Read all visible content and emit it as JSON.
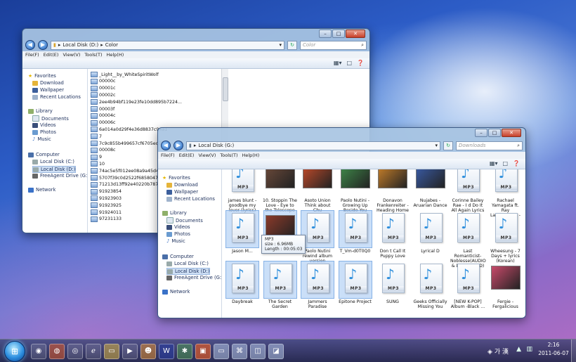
{
  "back_window": {
    "address": [
      "Local Disk (D:)",
      "Color"
    ],
    "search_placeholder": "Color",
    "menu": [
      "File(F)",
      "Edit(E)",
      "View(V)",
      "Tools(T)",
      "Help(H)"
    ],
    "nav": {
      "favorites": "Favorites",
      "download": "Download",
      "wallpaper": "Wallpaper",
      "recent": "Recent Locations",
      "library": "Library",
      "documents": "Documents",
      "videos": "Videos",
      "photos": "Photos",
      "music": "Music",
      "computer": "Computer",
      "drive_c": "Local Disk (C:)",
      "drive_d": "Local Disk (D:)",
      "drive_g": "FreeAgent Drive (G:)",
      "network": "Network"
    },
    "files": [
      "_Light__by_WhiteSpiritWolf",
      "00000c",
      "00001c",
      "00002c",
      "2ee4b94bf119e23fe10dd895b7224...",
      "00003f",
      "00004c",
      "00006c",
      "6a014a0d29f4e36d8837c94a1",
      "7",
      "7c9c855b499657cf6705ed7fc9",
      "00008c",
      "9",
      "10",
      "74ac5e5f012ee08a9a45d4ad07",
      "5707f39c0d2522f6858047c145",
      "71213d13ff92e40220b787a8d7",
      "91923854",
      "91923903",
      "91923925",
      "91924011",
      "97231133"
    ]
  },
  "front_window": {
    "address": [
      "Local Disk (G:)"
    ],
    "search_placeholder": "Downloads",
    "menu": [
      "File(F)",
      "Edit(E)",
      "View(V)",
      "Tools(T)",
      "Help(H)"
    ],
    "nav": {
      "favorites": "Favorites",
      "download": "Download",
      "wallpaper": "Wallpaper",
      "recent": "Recent Locations",
      "library": "Library",
      "documents": "Documents",
      "videos": "Videos",
      "photos": "Photos",
      "music": "Music",
      "computer": "Computer",
      "drive_c": "Local Disk (C:)",
      "drive_d": "Local Disk (D:)",
      "drive_g": "FreeAgent Drive (G:)",
      "network": "Network"
    },
    "mp3_badge": "MP3",
    "row1": [
      {
        "caption": "james blunt - goodbye my lover (lyrics)",
        "kind": "mp3"
      },
      {
        "caption": "10. Stoppin The Love - Eye to the Telescope",
        "kind": "photo",
        "color": "#6b4a3a"
      },
      {
        "caption": "Asoto Union Think about Chu",
        "kind": "photo",
        "color": "#c24b2a"
      },
      {
        "caption": "Paolo Nutini - Growing Up Beside You",
        "kind": "photo",
        "color": "#3f8a4a"
      },
      {
        "caption": "Donavon Frankenreiter - Heading Home",
        "kind": "photo",
        "color": "#c9802a"
      },
      {
        "caption": "Nujabes - Aruarian Dance",
        "kind": "photo",
        "color": "#3a5ca8"
      },
      {
        "caption": "Corinne Bailey Rae - I d Do It All Again Lyrics",
        "kind": "mp3"
      },
      {
        "caption": "Rachael Yamagata ft. Ray Lamontagne - Duet",
        "kind": "mp3"
      }
    ],
    "row2": [
      {
        "caption": "Jason M...",
        "kind": "mp3",
        "selected": true
      },
      {
        "caption": "",
        "kind": "photo",
        "color": "#8a3a2a",
        "selected": true
      },
      {
        "caption": "Paolo Nutini rewind album version",
        "kind": "mp3",
        "selected": true
      },
      {
        "caption": "T_Vm-d0T0Q0",
        "kind": "mp3",
        "selected": true
      },
      {
        "caption": "Don t Call It Puppy Love",
        "kind": "mp3"
      },
      {
        "caption": "Lyrical D",
        "kind": "mp3"
      },
      {
        "caption": "Last Romanticist-Noblesse(AUDIO & DOWNLOAD)",
        "kind": "mp3"
      },
      {
        "caption": "Wheesung - 7 Days + lyrics (Korean)",
        "kind": "mp3"
      }
    ],
    "row3": [
      {
        "caption": "Daybreak",
        "kind": "mp3",
        "selected": true
      },
      {
        "caption": "The Secret Garden",
        "kind": "mp3",
        "selected": true
      },
      {
        "caption": "Jammers Paradise",
        "kind": "mp3",
        "selected": true
      },
      {
        "caption": "Epitone Project",
        "kind": "mp3",
        "selected": true
      },
      {
        "caption": "SUNG",
        "kind": "mp3"
      },
      {
        "caption": "Geeks Officially Missing You",
        "kind": "mp3"
      },
      {
        "caption": "[NEW K-POP] Album -Black ...",
        "kind": "mp3"
      },
      {
        "caption": "Fergie - Fergalicious",
        "kind": "photo",
        "color": "#c84a6a"
      }
    ],
    "tooltip": {
      "type": "MP3",
      "size": "size : 6.96MB",
      "length": "Length : 00:05:03"
    }
  },
  "taskbar": {
    "ime": "가 漢",
    "time": "2:16",
    "date": "2011-06-07"
  }
}
